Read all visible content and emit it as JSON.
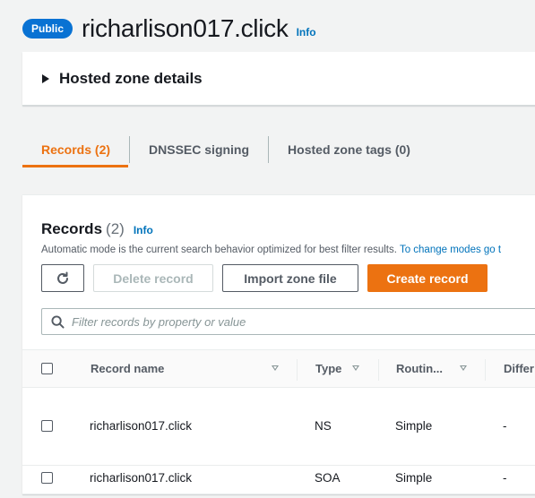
{
  "header": {
    "badge": "Public",
    "title": "richarlison017.click",
    "info": "Info"
  },
  "details_panel": {
    "label": "Hosted zone details"
  },
  "tabs": [
    {
      "label": "Records (2)",
      "active": true
    },
    {
      "label": "DNSSEC signing",
      "active": false
    },
    {
      "label": "Hosted zone tags (0)",
      "active": false
    }
  ],
  "records": {
    "title": "Records",
    "count": "(2)",
    "info": "Info",
    "description": "Automatic mode is the current search behavior optimized for best filter results.",
    "description_link": "To change modes go t",
    "buttons": {
      "refresh_icon": "refresh-icon",
      "delete": "Delete record",
      "import": "Import zone file",
      "create": "Create record"
    },
    "search_placeholder": "Filter records by property or value",
    "columns": [
      "Record name",
      "Type",
      "Routin...",
      "Differ"
    ],
    "rows": [
      {
        "name": "richarlison017.click",
        "type": "NS",
        "routing": "Simple",
        "diff": "-"
      },
      {
        "name": "richarlison017.click",
        "type": "SOA",
        "routing": "Simple",
        "diff": "-"
      }
    ]
  },
  "colors": {
    "accent": "#ec7211",
    "link": "#0073bb",
    "badge": "#0972d3"
  }
}
